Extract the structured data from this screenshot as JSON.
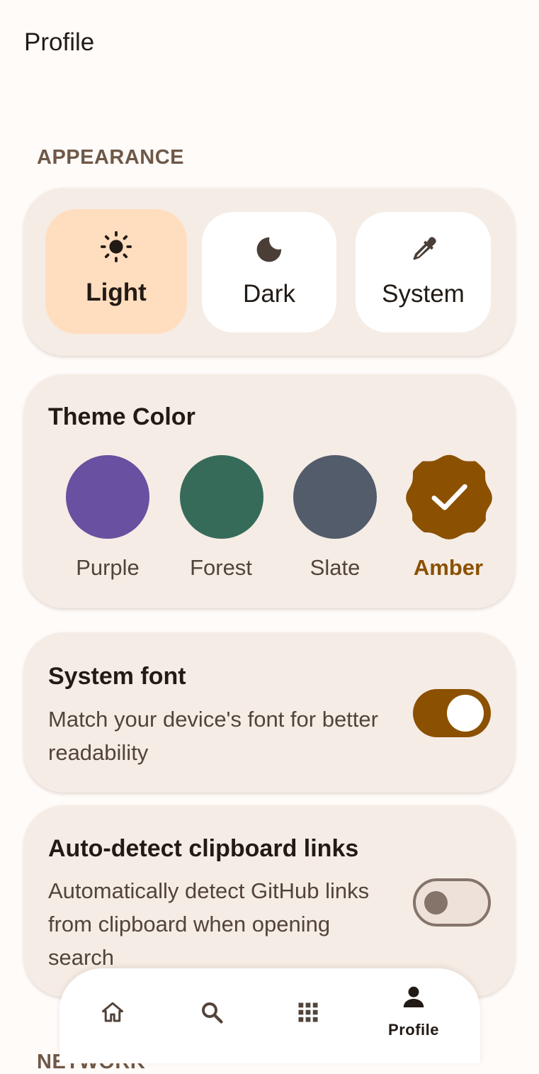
{
  "page": {
    "title": "Profile"
  },
  "appearance": {
    "section_label": "APPEARANCE",
    "modes": [
      {
        "label": "Light",
        "icon": "sun-icon",
        "selected": true
      },
      {
        "label": "Dark",
        "icon": "moon-icon",
        "selected": false
      },
      {
        "label": "System",
        "icon": "eyedropper-icon",
        "selected": false
      }
    ]
  },
  "theme_color": {
    "heading": "Theme Color",
    "options": [
      {
        "label": "Purple",
        "color": "#6950A0",
        "selected": false
      },
      {
        "label": "Forest",
        "color": "#366B5A",
        "selected": false
      },
      {
        "label": "Slate",
        "color": "#525C6B",
        "selected": false
      },
      {
        "label": "Amber",
        "color": "#8B5000",
        "selected": true
      }
    ]
  },
  "system_font": {
    "heading": "System font",
    "description": "Match your device's font for better readability",
    "enabled": true
  },
  "clipboard": {
    "heading": "Auto-detect clipboard links",
    "description": "Automatically detect GitHub links from clipboard when opening search",
    "enabled": false
  },
  "network": {
    "section_label": "NETWORK"
  },
  "nav": {
    "items": [
      {
        "icon": "home-icon",
        "label": ""
      },
      {
        "icon": "search-icon",
        "label": ""
      },
      {
        "icon": "apps-grid-icon",
        "label": ""
      },
      {
        "icon": "person-icon",
        "label": "Profile",
        "selected": true
      }
    ]
  },
  "colors": {
    "accent": "#8B5000",
    "selected_mode_bg": "#FFDDBF",
    "card_bg": "#F5ECE5",
    "section_label": "#6F5847"
  }
}
